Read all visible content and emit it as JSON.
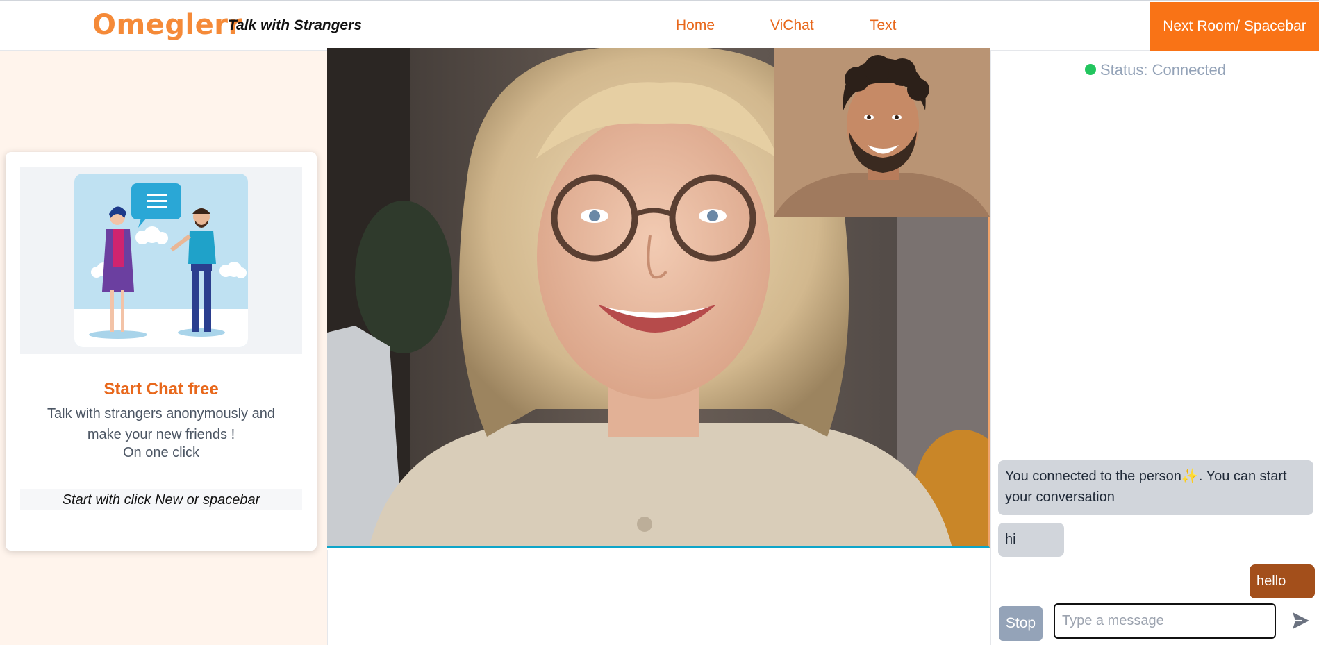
{
  "header": {
    "logo": "Omeglerr",
    "tagline": "Talk with Strangers",
    "nav": [
      "Home",
      "ViChat",
      "Text"
    ],
    "next_button": "Next Room/ Spacebar"
  },
  "promo_card": {
    "title": "Start Chat free",
    "description": "Talk with strangers anonymously and make your new friends !",
    "description_2": "On one click",
    "hint": "Start with click New or spacebar"
  },
  "chat": {
    "status": "Status: Connected",
    "messages": {
      "system_before": "You connected to the person",
      "system_emoji": "✨",
      "system_after": ". You can start your conversation",
      "stranger": "hi",
      "you": "hello"
    },
    "stop_button": "Stop",
    "input_placeholder": "Type a message"
  },
  "colors": {
    "brand": "#f97316",
    "nav_text": "#e8681c",
    "own_message": "#a34f1b",
    "status_connected": "#22c55e"
  },
  "icons": {
    "send": "send-icon",
    "status": "status-dot-icon"
  }
}
